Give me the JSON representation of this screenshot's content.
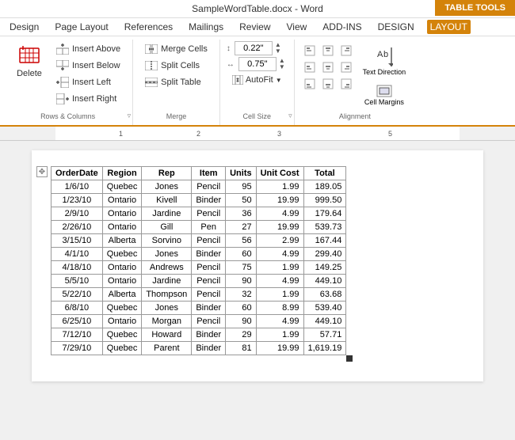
{
  "titleBar": {
    "title": "SampleWordTable.docx - Word",
    "tableToolsLabel": "TABLE TOOLS"
  },
  "menuBar": {
    "items": [
      "Design",
      "Page Layout",
      "References",
      "Mailings",
      "Review",
      "View",
      "ADD-INS",
      "DESIGN",
      "LAYOUT"
    ]
  },
  "ribbon": {
    "groups": [
      {
        "name": "rows-columns",
        "label": "Rows & Columns",
        "buttons": {
          "delete": "Delete",
          "insertAbove": "Insert Above",
          "insertBelow": "Insert Below",
          "insertLeft": "Insert Left",
          "insertRight": "Insert Right"
        }
      },
      {
        "name": "merge",
        "label": "Merge",
        "buttons": {
          "mergeCells": "Merge Cells",
          "splitCells": "Split Cells",
          "splitTable": "Split Table"
        }
      },
      {
        "name": "cell-size",
        "label": "Cell Size",
        "height": "0.22\"",
        "width": "0.75\"",
        "autofit": "AutoFit"
      },
      {
        "name": "alignment",
        "label": "Alignment",
        "textDirection": "Text Direction",
        "cellMargins": "Cell Margins"
      }
    ]
  },
  "table": {
    "headers": [
      "OrderDate",
      "Region",
      "Rep",
      "Item",
      "Units",
      "Unit Cost",
      "Total"
    ],
    "rows": [
      [
        "1/6/10",
        "Quebec",
        "Jones",
        "Pencil",
        "95",
        "1.99",
        "189.05"
      ],
      [
        "1/23/10",
        "Ontario",
        "Kivell",
        "Binder",
        "50",
        "19.99",
        "999.50"
      ],
      [
        "2/9/10",
        "Ontario",
        "Jardine",
        "Pencil",
        "36",
        "4.99",
        "179.64"
      ],
      [
        "2/26/10",
        "Ontario",
        "Gill",
        "Pen",
        "27",
        "19.99",
        "539.73"
      ],
      [
        "3/15/10",
        "Alberta",
        "Sorvino",
        "Pencil",
        "56",
        "2.99",
        "167.44"
      ],
      [
        "4/1/10",
        "Quebec",
        "Jones",
        "Binder",
        "60",
        "4.99",
        "299.40"
      ],
      [
        "4/18/10",
        "Ontario",
        "Andrews",
        "Pencil",
        "75",
        "1.99",
        "149.25"
      ],
      [
        "5/5/10",
        "Ontario",
        "Jardine",
        "Pencil",
        "90",
        "4.99",
        "449.10"
      ],
      [
        "5/22/10",
        "Alberta",
        "Thompson",
        "Pencil",
        "32",
        "1.99",
        "63.68"
      ],
      [
        "6/8/10",
        "Quebec",
        "Jones",
        "Binder",
        "60",
        "8.99",
        "539.40"
      ],
      [
        "6/25/10",
        "Ontario",
        "Morgan",
        "Pencil",
        "90",
        "4.99",
        "449.10"
      ],
      [
        "7/12/10",
        "Quebec",
        "Howard",
        "Binder",
        "29",
        "1.99",
        "57.71"
      ],
      [
        "7/29/10",
        "Quebec",
        "Parent",
        "Binder",
        "81",
        "19.99",
        "1,619.19"
      ]
    ]
  }
}
